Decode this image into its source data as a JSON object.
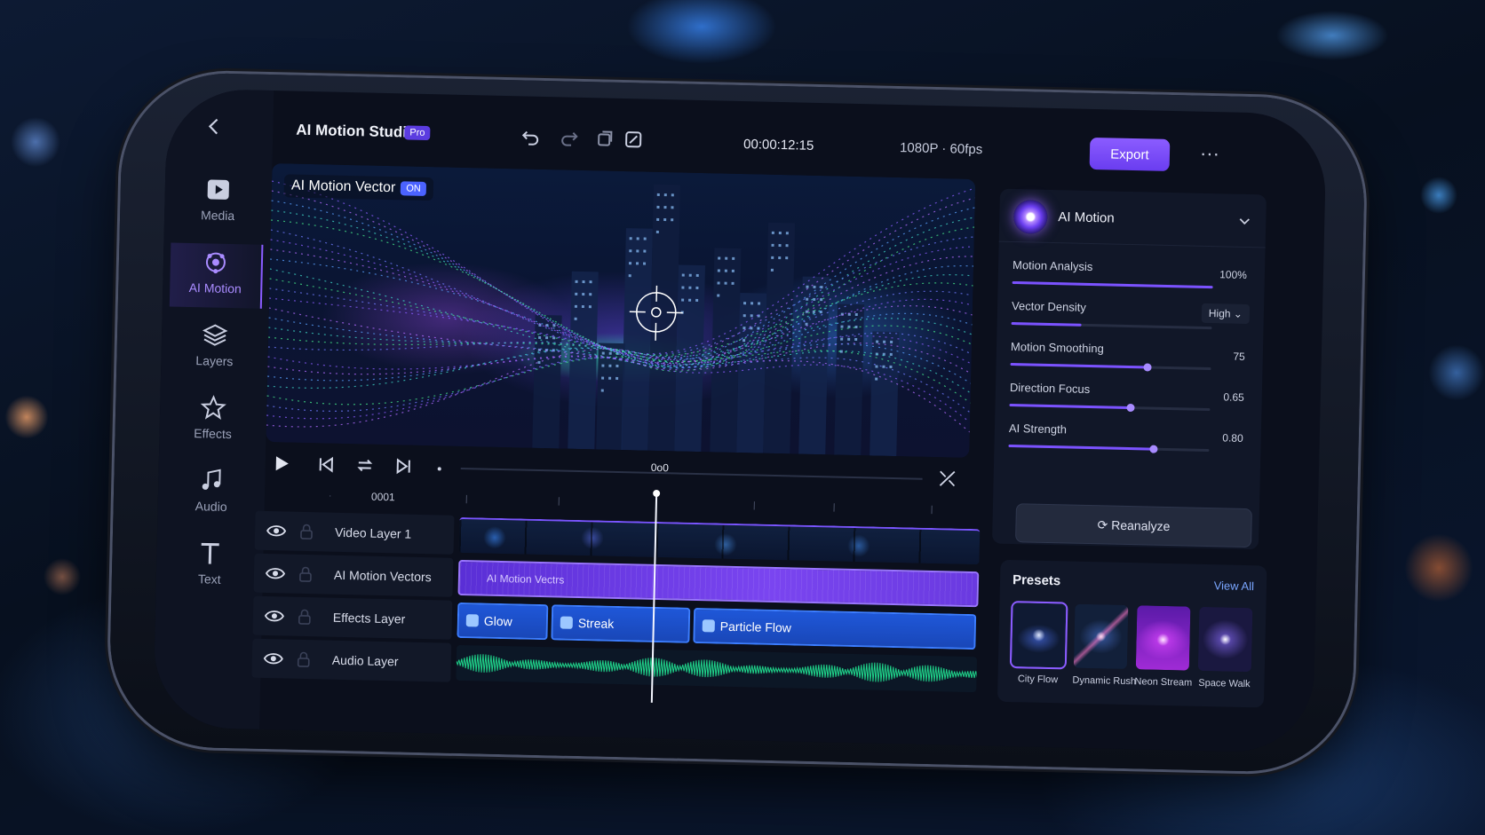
{
  "app": {
    "title": "AI Motion Studio",
    "badge": "Pro"
  },
  "nav": {
    "items": [
      {
        "label": "Media",
        "icon": "play-icon"
      },
      {
        "label": "AI Motion",
        "icon": "ai-motion-icon"
      },
      {
        "label": "Layers",
        "icon": "layers-icon"
      },
      {
        "label": "Effects",
        "icon": "star-icon"
      },
      {
        "label": "Audio",
        "icon": "music-note-icon"
      },
      {
        "label": "Text",
        "icon": "text-icon"
      }
    ]
  },
  "topbar": {
    "timecode": "00:00:12:15",
    "resolution": "1080P · 60fps",
    "export_label": "Export",
    "more_label": "···"
  },
  "preview": {
    "overlay_label": "AI Motion Vector",
    "overlay_badge": "ON"
  },
  "transport": {
    "position_label": "0o0"
  },
  "timeline": {
    "current_label": "0001",
    "tracks": [
      {
        "name": "Video Layer 1"
      },
      {
        "name": "AI Motion Vectors",
        "clip_label": "AI Motion Vectrs"
      },
      {
        "name": "Effects Layer",
        "clips": [
          "Glow",
          "Streak",
          "Particle Flow"
        ]
      },
      {
        "name": "Audio Layer"
      }
    ]
  },
  "ai_panel": {
    "title": "AI Motion",
    "params": [
      {
        "label": "Motion Analysis",
        "value": "100%",
        "level": 1.0
      },
      {
        "label": "Vector Density",
        "value": "High",
        "type": "dropdown",
        "level": 0.35
      },
      {
        "label": "Motion Smoothing",
        "value": "75",
        "level": 0.68
      },
      {
        "label": "Direction Focus",
        "value": "0.65",
        "level": 0.6
      },
      {
        "label": "AI Strength",
        "value": "0.80",
        "level": 0.72
      }
    ],
    "reanalyze_label": "Reanalyze"
  },
  "presets": {
    "title": "Presets",
    "view_all": "View All",
    "items": [
      {
        "name": "City Flow",
        "selected": true
      },
      {
        "name": "Dynamic Rush",
        "selected": false
      },
      {
        "name": "Neon Stream",
        "selected": false
      },
      {
        "name": "Space Walk",
        "selected": false
      }
    ]
  },
  "colors": {
    "accent": "#7b52ff",
    "clip_blue": "#1f57d8",
    "waveform": "#1fd38a"
  }
}
